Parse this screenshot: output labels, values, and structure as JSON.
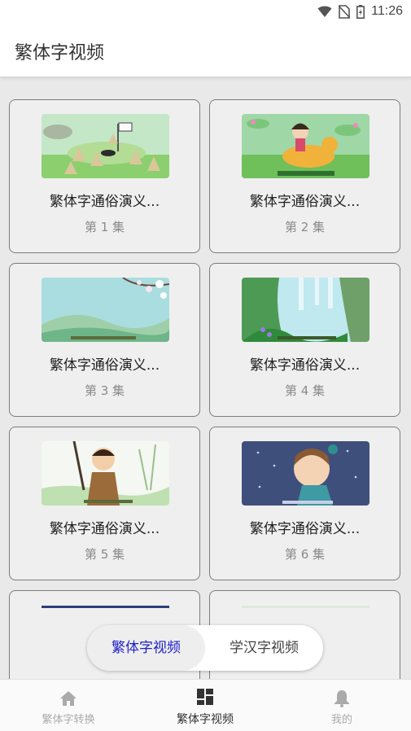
{
  "status": {
    "time": "11:26",
    "icons": [
      "wifi-icon",
      "no-sim-icon",
      "battery-charging-icon"
    ]
  },
  "appbar": {
    "title": "繁体字视频"
  },
  "videos": [
    {
      "title": "繁体字通俗演义...",
      "episode": "第 1 集"
    },
    {
      "title": "繁体字通俗演义...",
      "episode": "第 2 集"
    },
    {
      "title": "繁体字通俗演义...",
      "episode": "第 3 集"
    },
    {
      "title": "繁体字通俗演义...",
      "episode": "第 4 集"
    },
    {
      "title": "繁体字通俗演义...",
      "episode": "第 5 集"
    },
    {
      "title": "繁体字通俗演义...",
      "episode": "第 6 集"
    }
  ],
  "segmented": {
    "active": "繁体字视频",
    "inactive": "学汉字视频"
  },
  "bottom_nav": {
    "items": [
      {
        "label": "繁体字转换",
        "icon": "home-icon"
      },
      {
        "label": "繁体字视频",
        "icon": "dashboard-icon"
      },
      {
        "label": "我的",
        "icon": "bell-icon"
      }
    ]
  },
  "colors": {
    "accent": "#1f22c8",
    "card_border": "#7c7c7c",
    "background": "#e9e9e9"
  }
}
